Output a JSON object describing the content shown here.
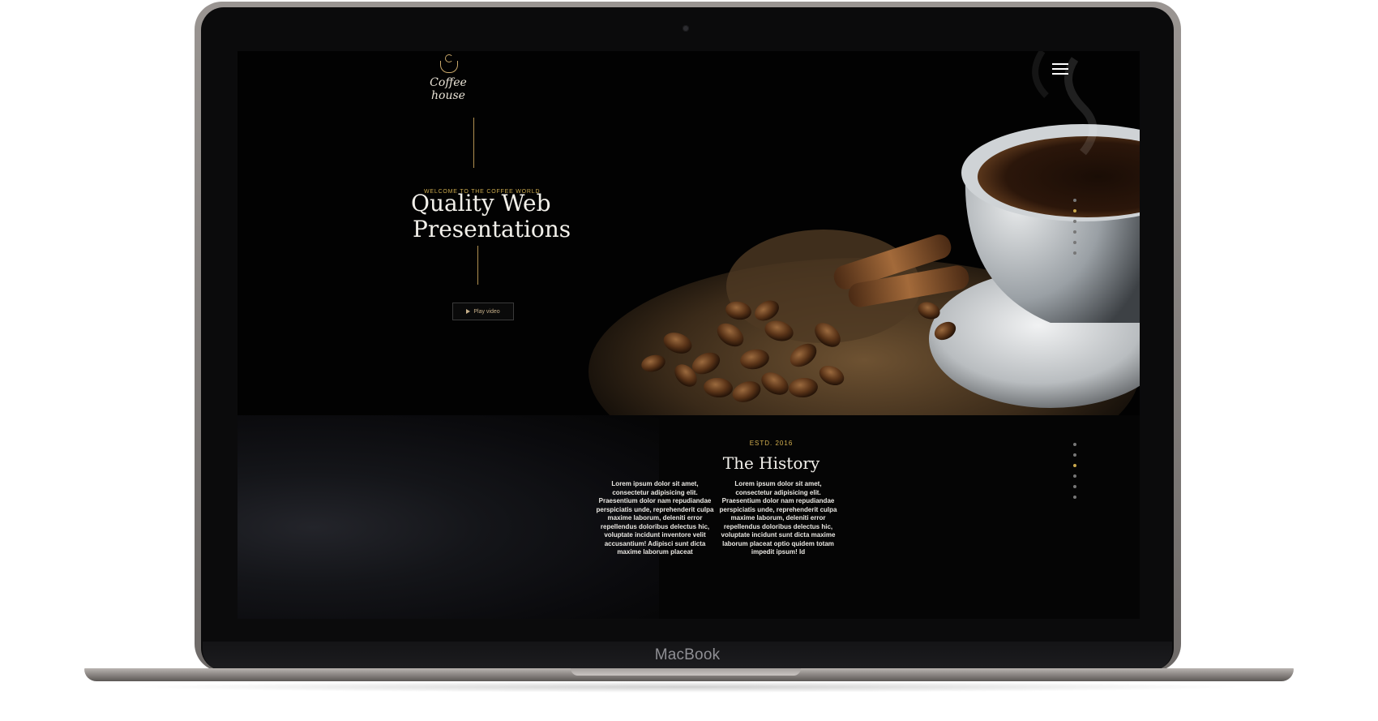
{
  "device": {
    "brand_label": "MacBook"
  },
  "site": {
    "logo_text": "Coffee house",
    "hero": {
      "eyebrow": "WELCOME TO THE COFFEE WORLD",
      "title_line1": "Quality Web",
      "title_line2": "Presentations",
      "play_button": "Play video"
    },
    "history": {
      "estd": "ESTD. 2016",
      "title": "The History",
      "col1": "Lorem ipsum dolor sit amet, consectetur adipisicing elit. Praesentium dolor nam repudiandae perspiciatis unde, reprehenderit culpa maxime laborum, deleniti error repellendus doloribus delectus hic, voluptate incidunt inventore velit accusantium! Adipisci sunt dicta maxime laborum placeat",
      "col2": "Lorem ipsum dolor sit amet, consectetur adipisicing elit. Praesentium dolor nam repudiandae perspiciatis unde, reprehenderit culpa maxime laborum, deleniti error repellendus doloribus delectus hic, voluptate incidunt sunt dicta maxime laborum placeat optio quidem totam impedit ipsum! Id"
    },
    "pager": {
      "hero_count": 6,
      "hero_active": 1,
      "history_count": 6,
      "history_active": 2
    }
  },
  "colors": {
    "accent": "#c9a84c",
    "background": "#040404"
  },
  "icons": {
    "menu": "hamburger-menu-icon",
    "play": "play-icon"
  }
}
